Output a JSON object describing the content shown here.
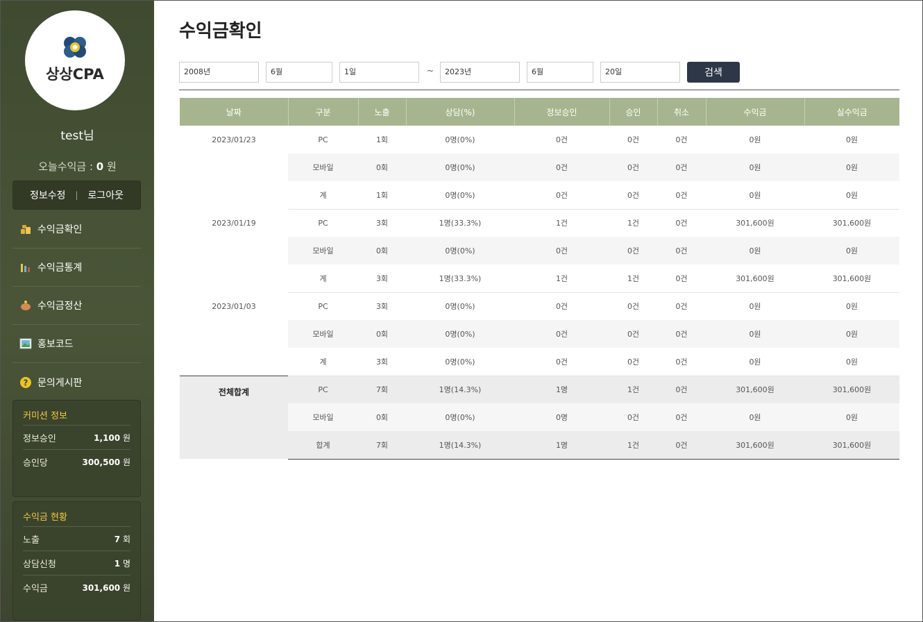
{
  "brand": {
    "logo_text": "상상CPA"
  },
  "user": {
    "name": "test님",
    "today_label": "오늘수익금 : ",
    "today_value": "0",
    "today_unit": " 원"
  },
  "account": {
    "edit": "정보수정",
    "sep": "|",
    "logout": "로그아웃"
  },
  "menu": [
    {
      "label": "수익금확인",
      "icon": "coins-icon"
    },
    {
      "label": "수익금통계",
      "icon": "bar-chart-icon"
    },
    {
      "label": "수익금정산",
      "icon": "piggy-bank-icon"
    },
    {
      "label": "홍보코드",
      "icon": "image-icon"
    },
    {
      "label": "문의게시판",
      "icon": "help-icon"
    }
  ],
  "commission": {
    "title": "커미션 정보",
    "rows": [
      {
        "label": "정보승인",
        "value": "1,100",
        "unit": " 원"
      },
      {
        "label": "승인당",
        "value": "300,500",
        "unit": " 원"
      }
    ]
  },
  "earnings_status": {
    "title": "수익금 현황",
    "rows": [
      {
        "label": "노출",
        "value": "7",
        "unit": " 회"
      },
      {
        "label": "상담신청",
        "value": "1",
        "unit": " 명"
      },
      {
        "label": "수익금",
        "value": "301,600",
        "unit": " 원"
      }
    ]
  },
  "page": {
    "title": "수익금확인"
  },
  "search": {
    "from_year": "2008년",
    "from_month": "6월",
    "from_day": "1일",
    "tilde": "~",
    "to_year": "2023년",
    "to_month": "6월",
    "to_day": "20일",
    "button": "검색"
  },
  "table": {
    "headers": [
      "날짜",
      "구분",
      "노출",
      "상담(%)",
      "정보승인",
      "승인",
      "취소",
      "수익금",
      "실수익금"
    ],
    "groups": [
      {
        "date": "2023/01/23",
        "rows": [
          [
            "PC",
            "1회",
            "0명(0%)",
            "0건",
            "0건",
            "0건",
            "0원",
            "0원"
          ],
          [
            "모바일",
            "0회",
            "0명(0%)",
            "0건",
            "0건",
            "0건",
            "0원",
            "0원"
          ],
          [
            "계",
            "1회",
            "0명(0%)",
            "0건",
            "0건",
            "0건",
            "0원",
            "0원"
          ]
        ]
      },
      {
        "date": "2023/01/19",
        "rows": [
          [
            "PC",
            "3회",
            "1명(33.3%)",
            "1건",
            "1건",
            "0건",
            "301,600원",
            "301,600원"
          ],
          [
            "모바일",
            "0회",
            "0명(0%)",
            "0건",
            "0건",
            "0건",
            "0원",
            "0원"
          ],
          [
            "계",
            "3회",
            "1명(33.3%)",
            "1건",
            "1건",
            "0건",
            "301,600원",
            "301,600원"
          ]
        ]
      },
      {
        "date": "2023/01/03",
        "rows": [
          [
            "PC",
            "3회",
            "0명(0%)",
            "0건",
            "0건",
            "0건",
            "0원",
            "0원"
          ],
          [
            "모바일",
            "0회",
            "0명(0%)",
            "0건",
            "0건",
            "0건",
            "0원",
            "0원"
          ],
          [
            "계",
            "3회",
            "0명(0%)",
            "0건",
            "0건",
            "0건",
            "0원",
            "0원"
          ]
        ]
      }
    ],
    "total": {
      "label": "전체합계",
      "rows": [
        [
          "PC",
          "7회",
          "1명(14.3%)",
          "1명",
          "1건",
          "0건",
          "301,600원",
          "301,600원"
        ],
        [
          "모바일",
          "0회",
          "0명(0%)",
          "0명",
          "0건",
          "0건",
          "0원",
          "0원"
        ],
        [
          "합계",
          "7회",
          "1명(14.3%)",
          "1명",
          "1건",
          "0건",
          "301,600원",
          "301,600원"
        ]
      ]
    }
  }
}
